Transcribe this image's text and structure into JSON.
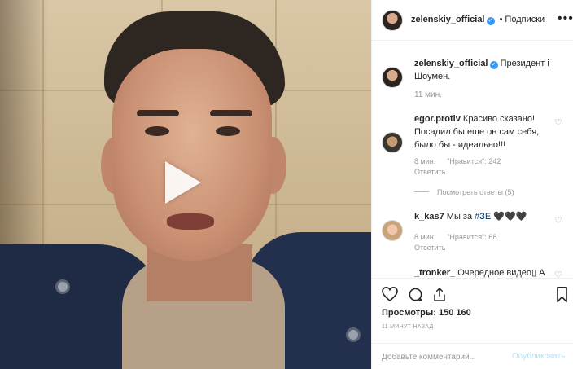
{
  "post": {
    "username": "zelenskiy_official",
    "separator": "•",
    "follow_label": "Подписки",
    "more_label": "•••",
    "caption": "Президент і Шоумен.",
    "caption_time": "11 мин."
  },
  "comments": [
    {
      "username": "egor.protiv",
      "text": "Красиво сказано! Посадил бы еще он сам себя, было бы - идеально!!!",
      "time": "8 мин.",
      "likes": "\"Нравится\": 242",
      "reply_label": "Ответить",
      "view_replies": "Посмотреть ответы (5)"
    },
    {
      "username": "k_kas7",
      "text_prefix": "Мы за ",
      "hashtag": "#ЗЕ",
      "text_suffix": " 🖤🖤🖤",
      "time": "8 мин.",
      "likes": "\"Нравится\": 68",
      "reply_label": "Ответить"
    },
    {
      "username": "_tronker_",
      "text": "Очередное видео▯ А"
    }
  ],
  "stats": {
    "views_label": "Просмотры:",
    "views_value": "150 160",
    "posted_ago": "11 МИНУТ НАЗАД"
  },
  "compose": {
    "placeholder": "Добавьте комментарий...",
    "publish_label": "Опубликовать"
  },
  "colors": {
    "link_blue": "#3897f0",
    "publish_disabled": "#b2dffc",
    "meta_grey": "#999999"
  },
  "icons": [
    "play-icon",
    "verified-icon",
    "more-icon",
    "heart-icon",
    "comment-icon",
    "share-icon",
    "bookmark-icon"
  ]
}
